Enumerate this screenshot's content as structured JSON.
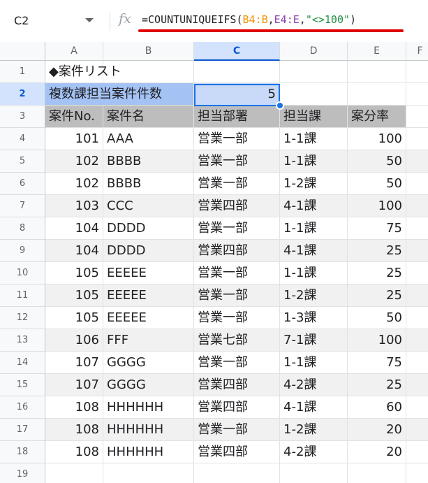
{
  "name_box": "C2",
  "formula_bar": {
    "fx_label": "fx",
    "parts": [
      "=COUNTUNIQUEIFS(",
      "B4:B",
      ",",
      "E4:E",
      ",",
      "\"<>100\"",
      ")"
    ]
  },
  "columns": [
    "A",
    "B",
    "C",
    "D",
    "E",
    "F"
  ],
  "rows": [
    "1",
    "2",
    "3",
    "4",
    "5",
    "6",
    "7",
    "8",
    "9",
    "10",
    "11",
    "12",
    "13",
    "14",
    "15",
    "16",
    "17",
    "18",
    "19"
  ],
  "sheet": {
    "title": "◆案件リスト",
    "count_label": "複数課担当案件件数",
    "count_value": "5",
    "headers": [
      "案件No.",
      "案件名",
      "担当部署",
      "担当課",
      "案分率"
    ],
    "data": [
      [
        "101",
        "AAA",
        "営業一部",
        "1-1課",
        "100"
      ],
      [
        "102",
        "BBBB",
        "営業一部",
        "1-1課",
        "50"
      ],
      [
        "102",
        "BBBB",
        "営業一部",
        "1-2課",
        "50"
      ],
      [
        "103",
        "CCC",
        "営業四部",
        "4-1課",
        "100"
      ],
      [
        "104",
        "DDDD",
        "営業一部",
        "1-1課",
        "75"
      ],
      [
        "104",
        "DDDD",
        "営業四部",
        "4-1課",
        "25"
      ],
      [
        "105",
        "EEEEE",
        "営業一部",
        "1-1課",
        "25"
      ],
      [
        "105",
        "EEEEE",
        "営業一部",
        "1-2課",
        "25"
      ],
      [
        "105",
        "EEEEE",
        "営業一部",
        "1-3課",
        "50"
      ],
      [
        "106",
        "FFF",
        "営業七部",
        "7-1課",
        "100"
      ],
      [
        "107",
        "GGGG",
        "営業一部",
        "1-1課",
        "75"
      ],
      [
        "107",
        "GGGG",
        "営業四部",
        "4-2課",
        "25"
      ],
      [
        "108",
        "HHHHHH",
        "営業四部",
        "4-1課",
        "60"
      ],
      [
        "108",
        "HHHHHH",
        "営業一部",
        "1-2課",
        "20"
      ],
      [
        "108",
        "HHHHHH",
        "営業四部",
        "4-2課",
        "20"
      ]
    ]
  },
  "colors": {
    "header_fill": "#bdbdbd",
    "label_fill": "#a4c2f4",
    "value_fill": "#c9daf8",
    "band_fill": "#f1f1f1",
    "selection": "#1a73e8",
    "annotation_underline": "#e00000"
  }
}
